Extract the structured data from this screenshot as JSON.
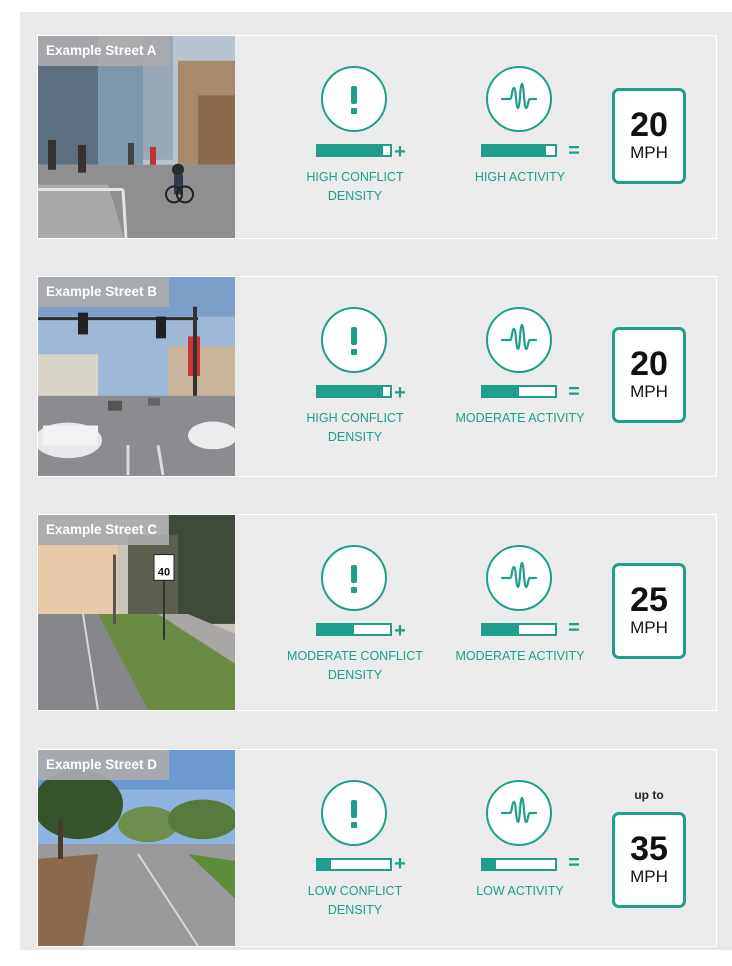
{
  "examples": [
    {
      "label": "Example Street A",
      "conflict": {
        "caption": "HIGH CONFLICT DENSITY",
        "level": 0.9
      },
      "activity": {
        "caption": "HIGH ACTIVITY",
        "level": 0.88
      },
      "operator_plus": "+",
      "operator_equals": "=",
      "speed": {
        "prefix": "",
        "value": "20",
        "unit": "MPH"
      }
    },
    {
      "label": "Example Street B",
      "conflict": {
        "caption": "HIGH CONFLICT DENSITY",
        "level": 0.9
      },
      "activity": {
        "caption": "MODERATE ACTIVITY",
        "level": 0.5
      },
      "operator_plus": "+",
      "operator_equals": "=",
      "speed": {
        "prefix": "",
        "value": "20",
        "unit": "MPH"
      }
    },
    {
      "label": "Example Street C",
      "conflict": {
        "caption": "MODERATE CONFLICT DENSITY",
        "level": 0.5
      },
      "activity": {
        "caption": "MODERATE ACTIVITY",
        "level": 0.5
      },
      "operator_plus": "+",
      "operator_equals": "=",
      "speed": {
        "prefix": "",
        "value": "25",
        "unit": "MPH"
      }
    },
    {
      "label": "Example Street D",
      "conflict": {
        "caption": "LOW CONFLICT DENSITY",
        "level": 0.18
      },
      "activity": {
        "caption": "LOW ACTIVITY",
        "level": 0.18
      },
      "operator_plus": "+",
      "operator_equals": "=",
      "speed": {
        "prefix": "up to",
        "value": "35",
        "unit": "MPH"
      }
    }
  ],
  "icons": {
    "conflict": "exclamation-icon",
    "activity": "waveform-icon"
  },
  "colors": {
    "accent": "#1f9e8c",
    "panel": "#ebebec",
    "label_bg": "#aaaaac"
  }
}
